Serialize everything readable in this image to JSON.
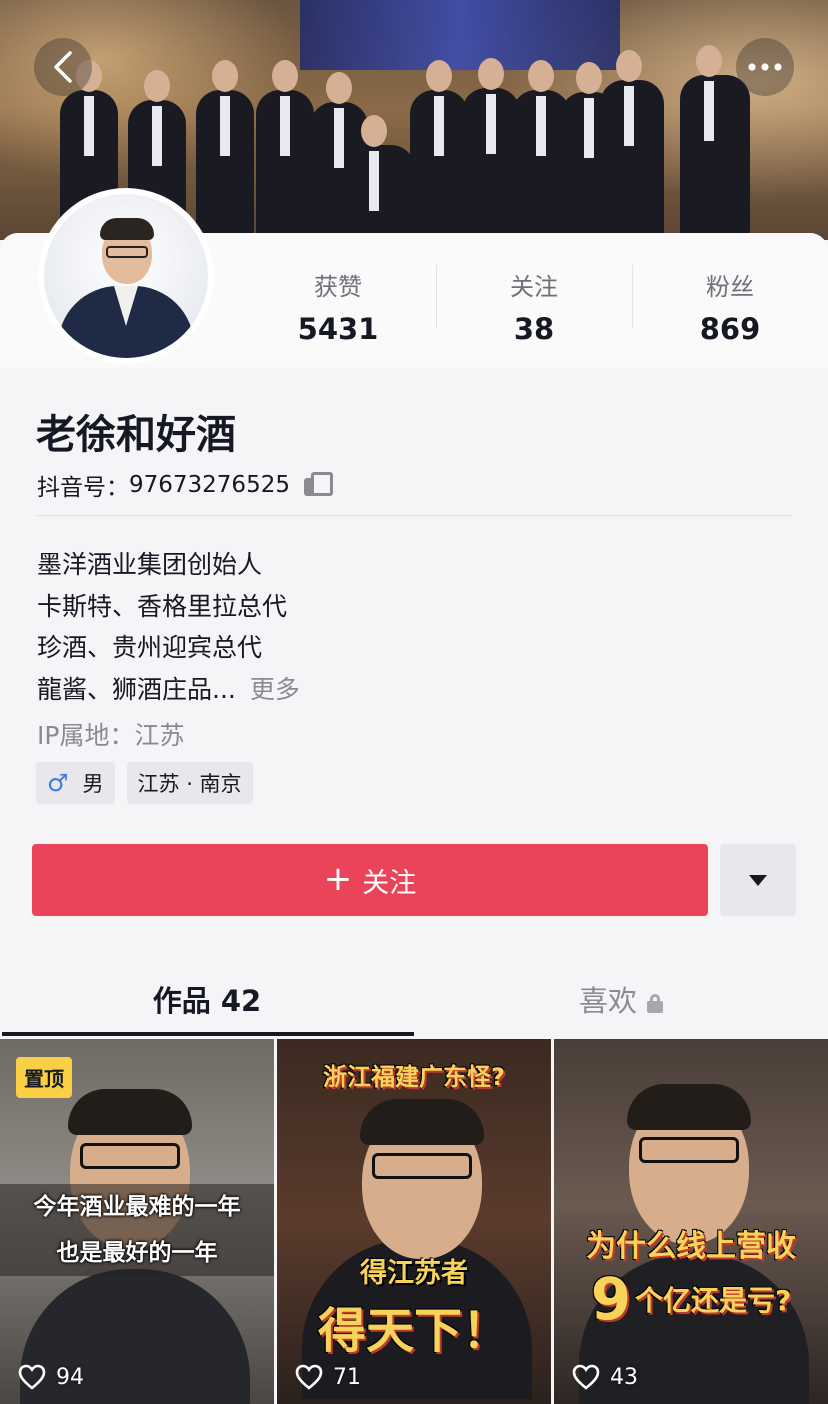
{
  "profile": {
    "name": "老徐和好酒",
    "uid_label": "抖音号：",
    "uid": "97673276525",
    "stats": [
      {
        "label": "获赞",
        "value": "5431"
      },
      {
        "label": "关注",
        "value": "38"
      },
      {
        "label": "粉丝",
        "value": "869"
      }
    ],
    "bio_lines": [
      "墨洋酒业集团创始人",
      "卡斯特、香格里拉总代",
      "珍酒、贵州迎宾总代",
      "龍酱、狮酒庄品..."
    ],
    "bio_more": "更多",
    "ip": "IP属地：江苏",
    "tags": {
      "gender_icon": "♂",
      "gender": "男",
      "location": "江苏 · 南京"
    }
  },
  "actions": {
    "follow_plus": "+",
    "follow_label": "关注"
  },
  "tabs": {
    "works": "作品 42",
    "likes": "喜欢"
  },
  "videos": [
    {
      "pinned": "置顶",
      "line1": "今年酒业最难的一年",
      "line2": "也是最好的一年",
      "likes": "94"
    },
    {
      "top": "浙江福建广东怪?",
      "line1": "得江苏者",
      "line2": "得天下！",
      "likes": "71"
    },
    {
      "line1": "为什么线上营收",
      "num": "9",
      "line2": "个亿还是亏?",
      "likes": "43"
    }
  ],
  "icons": {
    "back": "back-chevron-icon",
    "more": "more-dots-icon",
    "copy": "copy-icon",
    "lock": "lock-icon",
    "heart": "heart-icon",
    "male": "male-icon",
    "dropdown": "caret-down-icon"
  },
  "colors": {
    "follow_button": "#e9445a",
    "pin_badge": "#f9cf45",
    "male_icon": "#3c7be6",
    "caption_yellow": "#f6d35a"
  }
}
